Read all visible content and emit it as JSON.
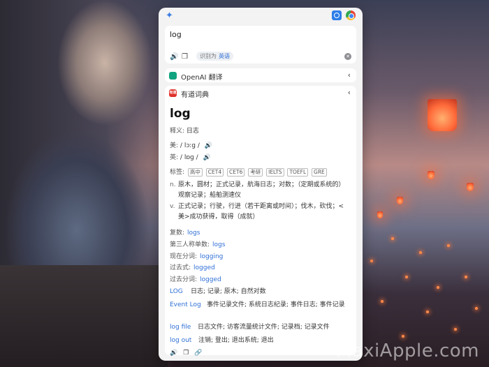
{
  "header": {
    "pin_icon": "pin-icon",
    "search_icon": "search-icon",
    "chrome_icon": "chrome-icon"
  },
  "input": {
    "query": "log",
    "detected_prefix": "识别为",
    "detected_lang": "英语"
  },
  "services": {
    "openai": {
      "name": "OpenAI 翻译"
    },
    "youdao": {
      "name": "有道词典",
      "logo_text": "有道"
    }
  },
  "result": {
    "word": "log",
    "meaning_label": "释义:",
    "meaning": "日志",
    "us_label": "美:",
    "us_phonetic": "/ lɔːɡ /",
    "uk_label": "英:",
    "uk_phonetic": "/ lɒɡ /",
    "tags_label": "标签:",
    "tags": [
      "高中",
      "CET4",
      "CET6",
      "考研",
      "IELTS",
      "TOEFL",
      "GRE"
    ],
    "definitions": [
      {
        "pos": "n.",
        "text": "原木，圆材；正式记录，航海日志；对数；（定期或系统的）观察记录；船舶测速仪"
      },
      {
        "pos": "v.",
        "text": "正式记录；行驶，行进（若干距离或时间）；伐木，砍伐；<美>成功获得，取得（成就）"
      }
    ],
    "forms": [
      {
        "label": "复数:",
        "value": "logs"
      },
      {
        "label": "第三人称单数:",
        "value": "logs"
      },
      {
        "label": "现在分词:",
        "value": "logging"
      },
      {
        "label": "过去式:",
        "value": "logged"
      },
      {
        "label": "过去分词:",
        "value": "logged"
      }
    ],
    "phrases": [
      {
        "key": "LOG",
        "value": "日志; 记录; 原木; 自然对数"
      },
      {
        "key": "Event Log",
        "value": "事件记录文件; 系统日志纪录; 事件日志; 事件记录"
      },
      {
        "key": "log file",
        "value": "日志文件; 访客流量统计文件; 记录档; 记录文件"
      },
      {
        "key": "log out",
        "value": "注销; 登出; 退出系统; 退出"
      }
    ]
  },
  "watermark": "MaxiApple.com"
}
